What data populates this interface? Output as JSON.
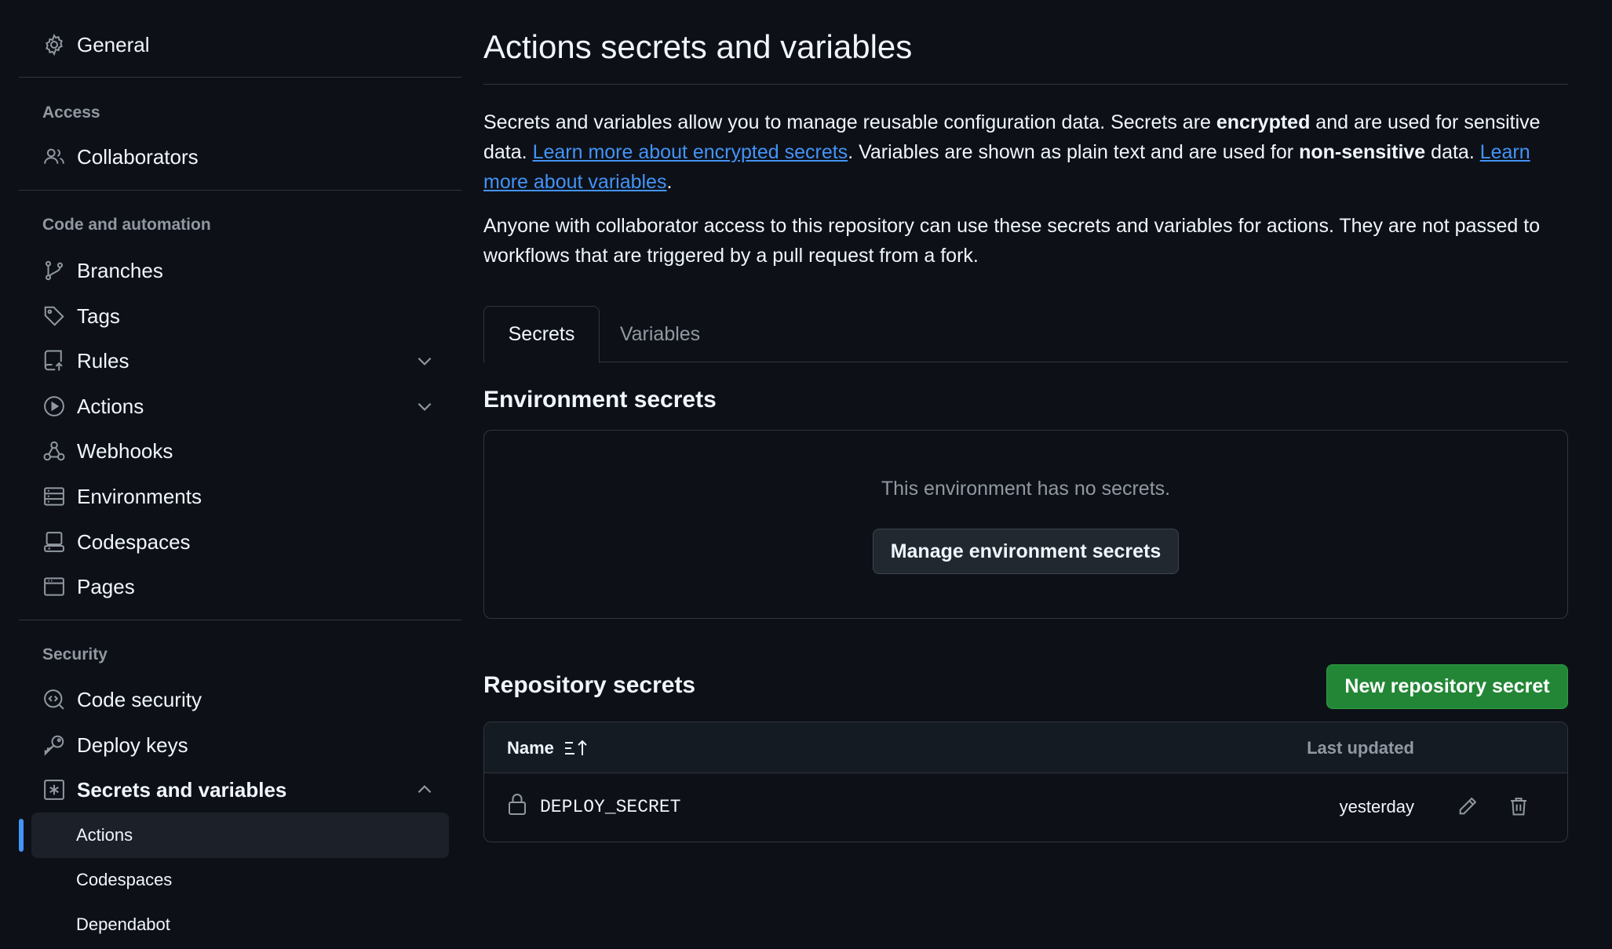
{
  "sidebar": {
    "general": {
      "label": "General",
      "icon": "gear-icon"
    },
    "access_heading": "Access",
    "collaborators": {
      "label": "Collaborators",
      "icon": "people-icon"
    },
    "code_heading": "Code and automation",
    "branches": {
      "label": "Branches",
      "icon": "git-branch-icon"
    },
    "tags": {
      "label": "Tags",
      "icon": "tag-icon"
    },
    "rules": {
      "label": "Rules",
      "icon": "repo-push-icon",
      "expanded": false
    },
    "actions": {
      "label": "Actions",
      "icon": "play-icon",
      "expanded": false
    },
    "webhooks": {
      "label": "Webhooks",
      "icon": "webhook-icon"
    },
    "environments": {
      "label": "Environments",
      "icon": "server-icon"
    },
    "codespaces": {
      "label": "Codespaces",
      "icon": "codespaces-icon"
    },
    "pages": {
      "label": "Pages",
      "icon": "browser-icon"
    },
    "security_heading": "Security",
    "code_security": {
      "label": "Code security",
      "icon": "codescan-icon"
    },
    "deploy_keys": {
      "label": "Deploy keys",
      "icon": "key-icon"
    },
    "secrets_vars": {
      "label": "Secrets and variables",
      "icon": "key-asterisk-icon",
      "expanded": true
    },
    "sub_items": [
      {
        "label": "Actions",
        "active": true
      },
      {
        "label": "Codespaces",
        "active": false
      },
      {
        "label": "Dependabot",
        "active": false
      }
    ]
  },
  "main": {
    "title": "Actions secrets and variables",
    "intro": {
      "part1": "Secrets and variables allow you to manage reusable configuration data. Secrets are ",
      "bold1": "encrypted",
      "part2": " and are used for sensitive data. ",
      "link1": "Learn more about encrypted secrets",
      "part3": ". Variables are shown as plain text and are used for ",
      "bold2": "non-sensitive",
      "part4": " data. ",
      "link2": "Learn more about variables",
      "part5": "."
    },
    "access_note": "Anyone with collaborator access to this repository can use these secrets and variables for actions. They are not passed to workflows that are triggered by a pull request from a fork.",
    "tabs": [
      {
        "label": "Secrets",
        "selected": true
      },
      {
        "label": "Variables",
        "selected": false
      }
    ],
    "environment_secrets": {
      "heading": "Environment secrets",
      "empty_text": "This environment has no secrets.",
      "button": "Manage environment secrets"
    },
    "repository_secrets": {
      "heading": "Repository secrets",
      "new_button": "New repository secret",
      "columns": {
        "name": "Name",
        "updated": "Last updated"
      },
      "rows": [
        {
          "name": "DEPLOY_SECRET",
          "updated": "yesterday"
        }
      ]
    }
  },
  "colors": {
    "background": "#0d1117",
    "accent_link": "#4493f8",
    "primary_button": "#238636",
    "border": "#30363d",
    "muted_text": "#9198a1"
  }
}
